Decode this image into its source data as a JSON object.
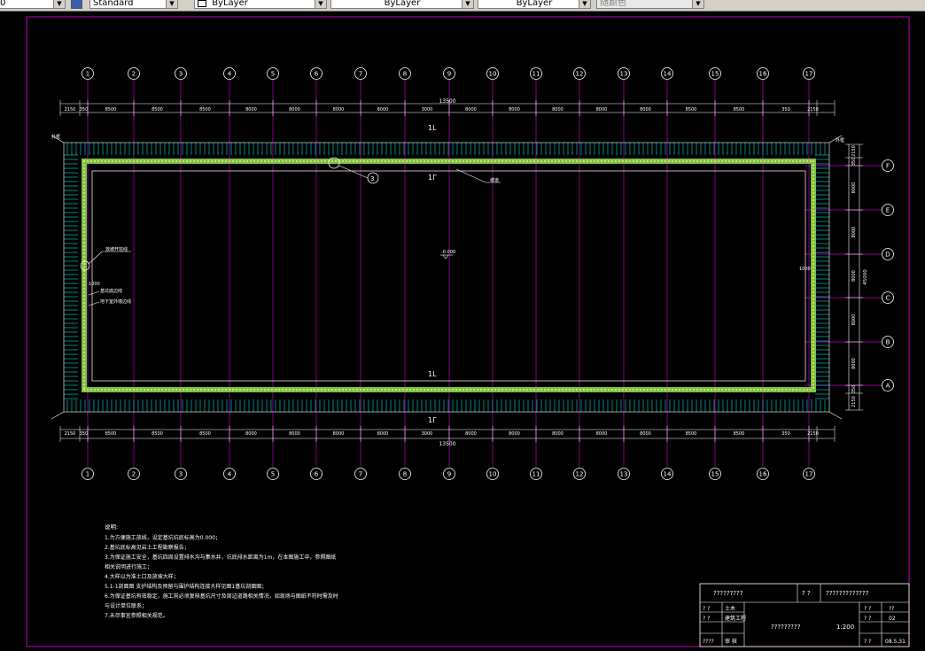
{
  "toolbar": {
    "layer_value": "0",
    "textstyle_value": "Standard",
    "layer_control": "ByLayer",
    "linetype_control": "ByLayer",
    "lineweight_control": "ByLayer",
    "plotstyle_control": "随颜色"
  },
  "colors": {
    "frame": "#c000c0",
    "axis_line": "#c000c0",
    "bubble": "#ffffff",
    "dims": "#ffffff",
    "rebar": "#00e0e0",
    "wall_fill": "#7cc04a",
    "wall_dots": "#ffff66"
  },
  "drawing": {
    "top_axis_labels": [
      "1",
      "2",
      "3",
      "4",
      "5",
      "6",
      "7",
      "8",
      "9",
      "10",
      "11",
      "12",
      "13",
      "14",
      "15",
      "16",
      "17"
    ],
    "right_axis_labels": [
      "F",
      "E",
      "D",
      "C",
      "B",
      "A"
    ],
    "top_total_dim": "13500",
    "bottom_total_dim": "13500",
    "top_dims": [
      "2150",
      "350",
      "8500",
      "8500",
      "8500",
      "8000",
      "8000",
      "8000",
      "8000",
      "3000",
      "8000",
      "8000",
      "8000",
      "8000",
      "8000",
      "8500",
      "8500",
      "350",
      "2150"
    ],
    "right_dims": [
      "2150",
      "350",
      "8000",
      "8000",
      "8000",
      "8000",
      "8000",
      "350",
      "2150"
    ],
    "right_total_dim": "45000",
    "label_1l_top": "1L",
    "label_1l_inner_top": "1Γ",
    "label_1l_bottom": "1L",
    "label_1l_inner_bottom": "1Γ",
    "elevation_mark": "-0.000",
    "callout_3": "3",
    "callout_right_text": "坡道",
    "left_wall_note": "放坡开挖线",
    "left_inner_note_1": "基坑底边线",
    "left_inner_note_2": "地下室外墙边线",
    "left_dim_1000": "1000",
    "right_dim_1000": "1000",
    "corner_tl": "外框",
    "corner_tr": "外框"
  },
  "notes": {
    "title": "说明:",
    "lines": [
      "1.为方便施工放线，设定基坑坑底标高为0.000；",
      "2.基坑底标高见岩土工程勘察报告；",
      "3.为保证施工安全，基坑四周设置排水沟与集水井，坑底排水距离为1m，在本图施工中，参照图纸",
      "  相关说明进行施工；",
      "4.大样以为准土口及放坡大样；",
      "5.1-1剖面图  支护结构及预留与围护结构连接大样见图1基坑剖面图；",
      "6.为保证基坑有效稳定，施工前必须复核基坑尺寸及周边道路相关情况，如现场与图纸不符时需及时",
      "  与设计单位联系；",
      "7.未尽事宜参照相关规范。"
    ]
  },
  "title_block": {
    "project": "?????????",
    "label_q": "? ?",
    "drawing_name": "?????????????",
    "row1_l1": "? ?",
    "row1_l2": "土木",
    "row2_l1": "? ?",
    "row2_l2": "建筑工程",
    "row3_l1": "????",
    "row3_l2": "审 核",
    "center_text": "?????????",
    "scale": "1:200",
    "r1_a": "? ?",
    "r1_b": "??",
    "r2_a": "? ?",
    "r2_b": "02",
    "r3_a": "? ?",
    "r3_b": "08.5.31"
  }
}
